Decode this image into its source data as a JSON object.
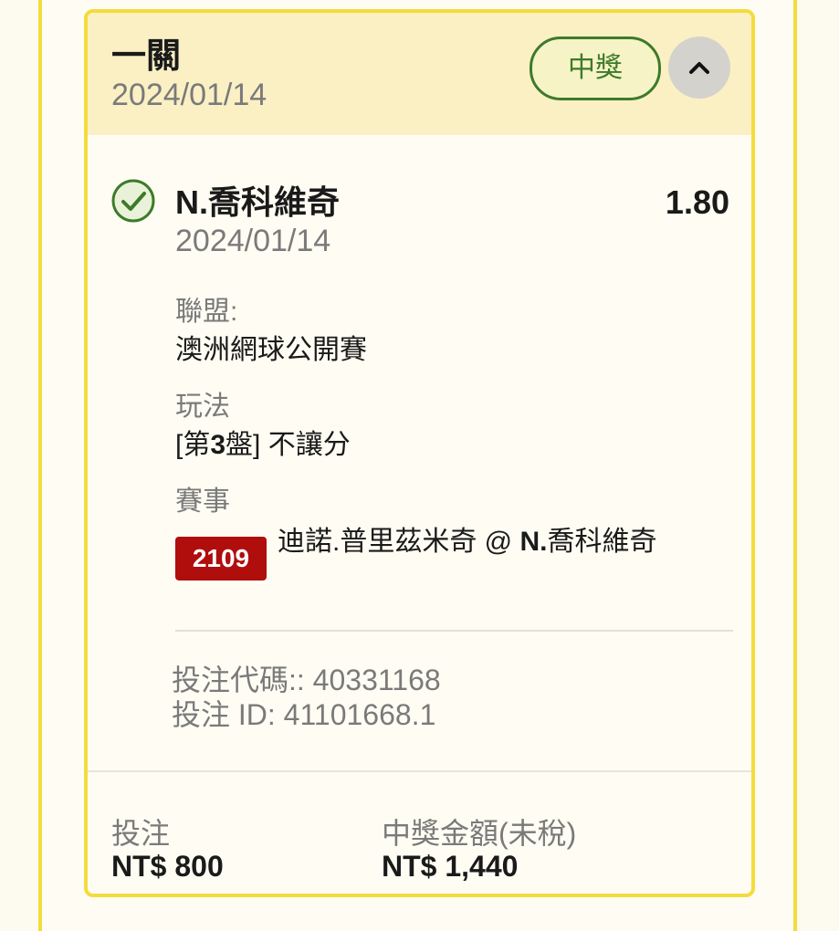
{
  "header": {
    "bet_type": "一關",
    "date": "2024/01/14",
    "status": "中獎"
  },
  "selection": {
    "name": "N.喬科維奇",
    "date": "2024/01/14",
    "odds": "1.80",
    "league_label": "聯盟:",
    "league": "澳洲網球公開賽",
    "market_label": "玩法",
    "market_prefix": "[第",
    "market_set": "3",
    "market_suffix": "盤] 不讓分",
    "event_label": "賽事",
    "event_code": "2109",
    "event_name_part1": "迪諾.普里茲米奇 @ ",
    "event_name_part2": "N.",
    "event_name_part3": "喬科維奇"
  },
  "reference": {
    "bet_code": "投注代碼:: 40331168",
    "bet_id": "投注 ID: 41101668.1"
  },
  "footer": {
    "stake_label": "投注",
    "stake_value": "NT$ 800",
    "payout_label": "中獎金額(未稅)",
    "payout_value": "NT$ 1,440"
  },
  "colors": {
    "accent_yellow": "#f3dc3c",
    "header_bg": "#fbf0c4",
    "win_green": "#3d7a2a",
    "event_red": "#b00d0d"
  },
  "icons": {
    "status": "check-circle-icon",
    "collapse": "chevron-up-icon"
  }
}
